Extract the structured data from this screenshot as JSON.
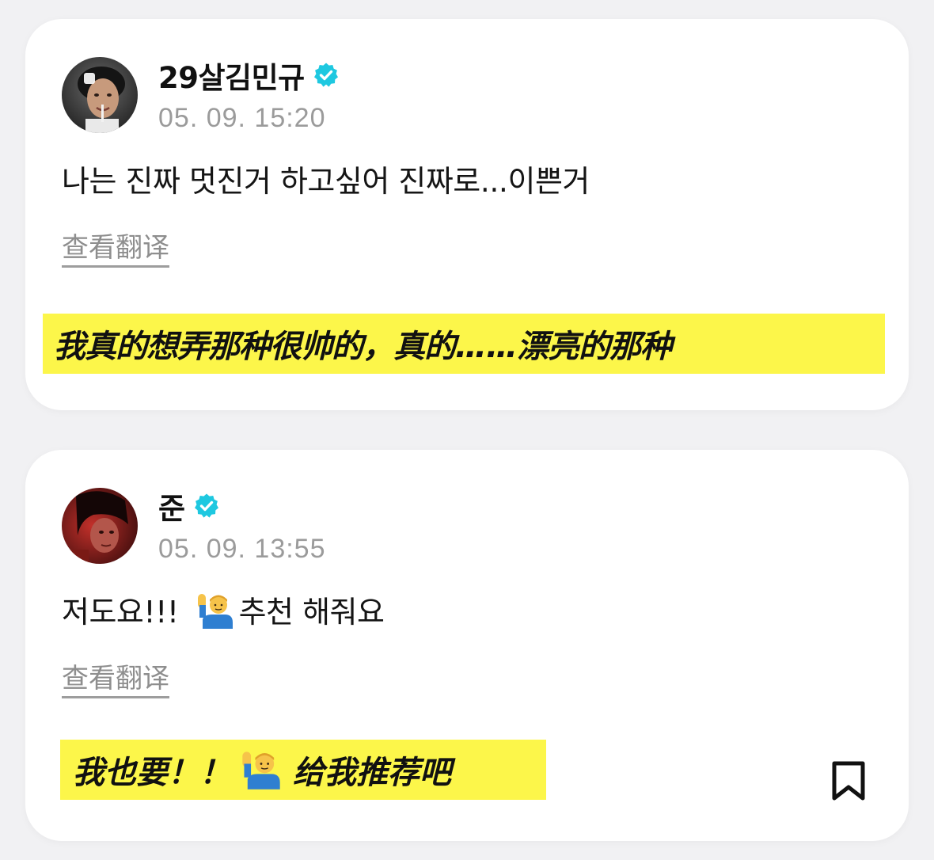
{
  "colors": {
    "page_background": "#f1f1f3",
    "card_background": "#ffffff",
    "verified_badge": "#1ec8e0",
    "translation_highlight": "#fcf64a",
    "timestamp_text": "#9b9b9b"
  },
  "posts": [
    {
      "avatar_icon": "user-avatar-photo",
      "username": "29살김민규",
      "verified_icon": "verified-badge-icon",
      "timestamp": "05. 09. 15:20",
      "text": "나는 진짜 멋진거 하고싶어 진짜로...이쁜거",
      "translate_label": "查看翻译",
      "translation": "我真的想弄那种很帅的，真的……漂亮的那种"
    },
    {
      "avatar_icon": "user-avatar-photo",
      "username": "준",
      "verified_icon": "verified-badge-icon",
      "timestamp": "05. 09. 13:55",
      "text_before_emoji": "저도요!!!",
      "emoji_icon": "person-raising-hand-emoji",
      "text_after_emoji": "추천 해줘요",
      "translate_label": "查看翻译",
      "translation_before_emoji": "我也要！！",
      "translation_after_emoji": "给我推荐吧",
      "bookmark_icon": "bookmark-icon"
    }
  ]
}
